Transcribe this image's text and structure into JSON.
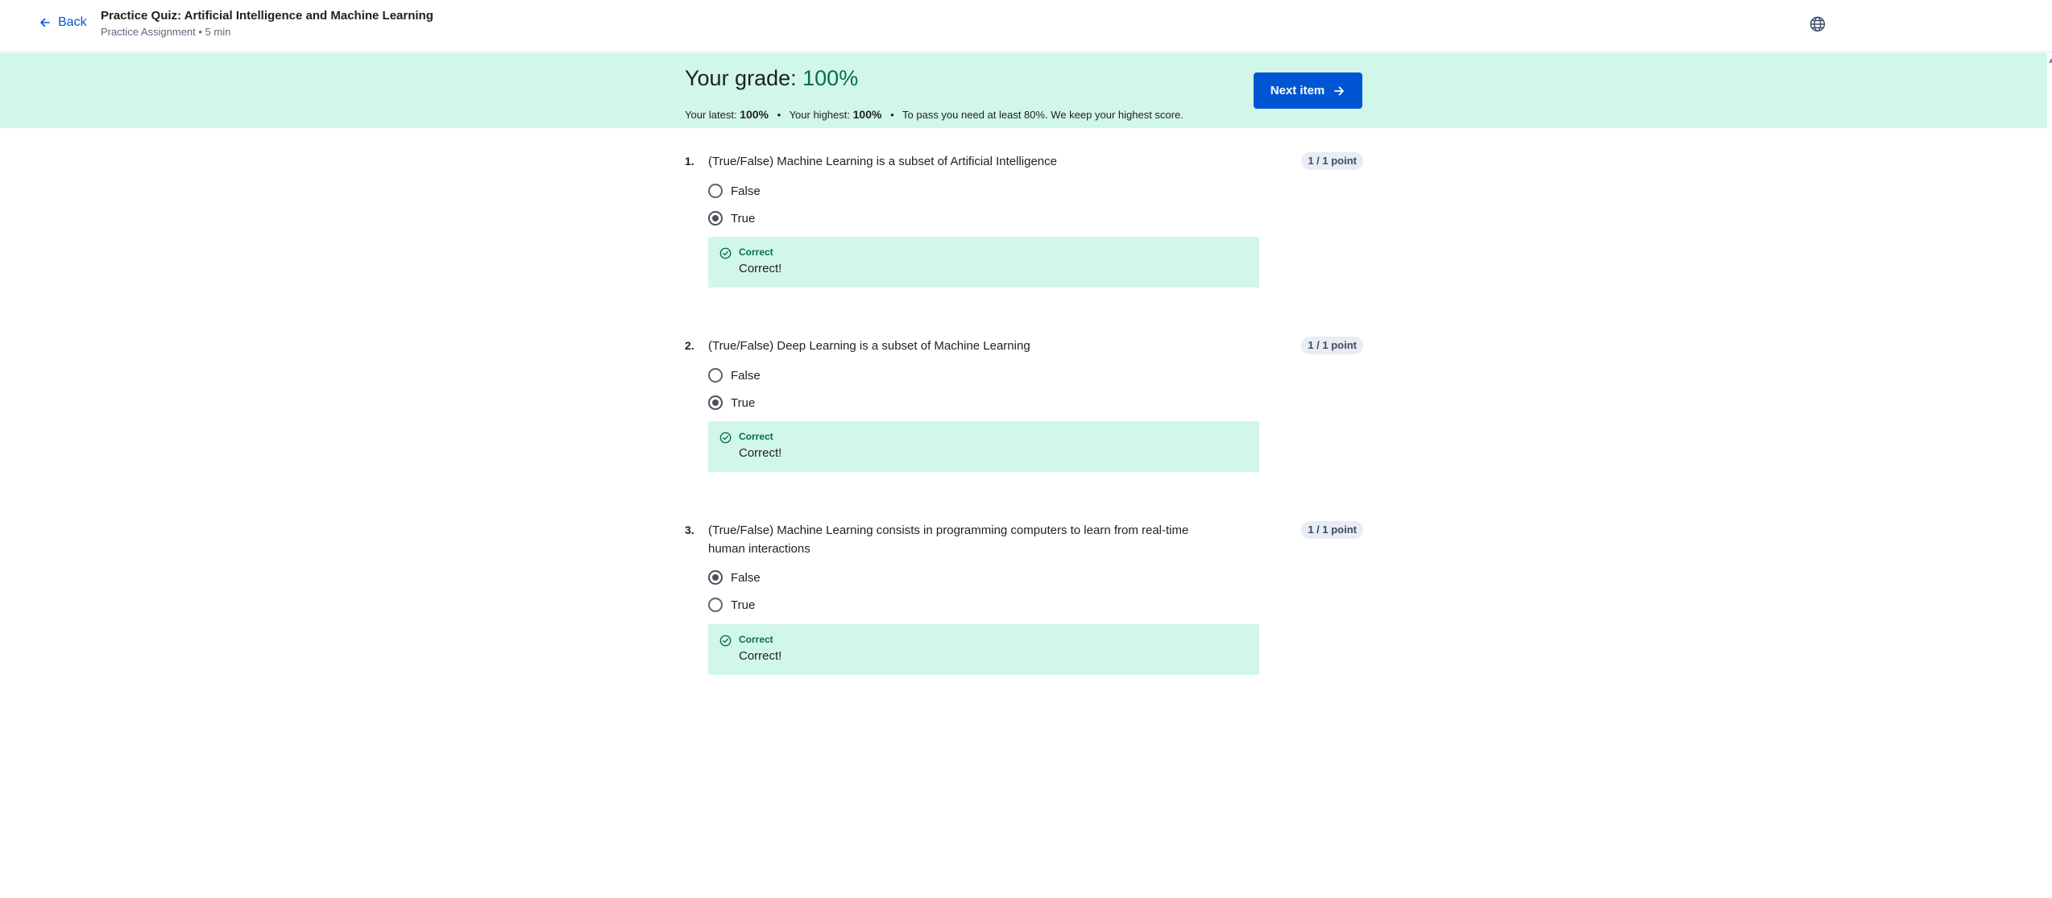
{
  "header": {
    "back_label": "Back",
    "title": "Practice Quiz: Artificial Intelligence and Machine Learning",
    "subtitle": "Practice Assignment • 5 min",
    "globe_icon": "globe-icon"
  },
  "grade": {
    "label": "Your grade:",
    "value": "100%",
    "latest_label": "Your latest:",
    "latest_value": "100%",
    "highest_label": "Your highest:",
    "highest_value": "100%",
    "pass_note": "To pass you need at least 80%. We keep your highest score.",
    "separator": "•",
    "next_label": "Next item"
  },
  "questions": [
    {
      "number": "1.",
      "text": "(True/False) Machine Learning is a subset of Artificial Intelligence",
      "points": "1 / 1 point",
      "options": [
        {
          "label": "False",
          "selected": false
        },
        {
          "label": "True",
          "selected": true
        }
      ],
      "feedback_title": "Correct",
      "feedback_text": "Correct!"
    },
    {
      "number": "2.",
      "text": "(True/False) Deep Learning is a subset of Machine Learning",
      "points": "1 / 1 point",
      "options": [
        {
          "label": "False",
          "selected": false
        },
        {
          "label": "True",
          "selected": true
        }
      ],
      "feedback_title": "Correct",
      "feedback_text": "Correct!"
    },
    {
      "number": "3.",
      "text": "(True/False) Machine Learning consists in programming computers to learn from real-time human interactions",
      "points": "1 / 1 point",
      "options": [
        {
          "label": "False",
          "selected": true
        },
        {
          "label": "True",
          "selected": false
        }
      ],
      "feedback_title": "Correct",
      "feedback_text": "Correct!"
    }
  ],
  "colors": {
    "accent": "#0056d2",
    "success_bg": "#d1f7ea",
    "success_text": "#0a6b4e"
  }
}
